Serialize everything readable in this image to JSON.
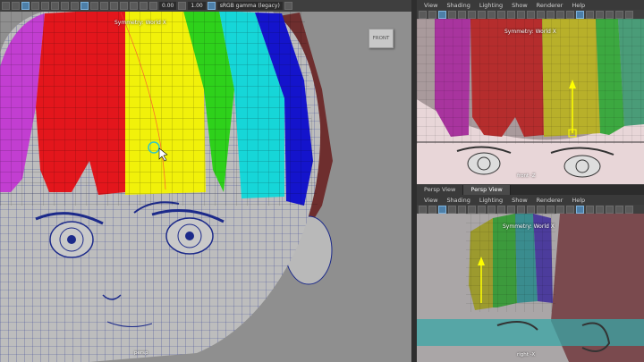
{
  "app": {
    "main_viewport": {
      "gamma_field": "sRGB gamma (legacy)",
      "exposure_value": "0.00",
      "gamma_value": "1.00",
      "symmetry_label": "Symmetry: World X",
      "view_cube_label": "FRONT",
      "camera_label": "persp"
    },
    "front_panel": {
      "menu": [
        "View",
        "Shading",
        "Lighting",
        "Show",
        "Renderer",
        "Help"
      ],
      "symmetry_label": "Symmetry: World X",
      "camera_label": "front -Z"
    },
    "panel_tabs": [
      "Persp View",
      "Persp View"
    ],
    "side_panel": {
      "menu": [
        "View",
        "Shading",
        "Lighting",
        "Show",
        "Renderer",
        "Help"
      ],
      "symmetry_label": "Symmetry: World X",
      "camera_label": "right -X"
    },
    "colors": {
      "bang_purple": "#c23ed1",
      "bang_red": "#e3161c",
      "bang_yellow": "#f1f10a",
      "bang_green": "#2ed11b",
      "bang_cyan": "#16d6d8",
      "bang_blue": "#1414cc",
      "wire": "#1c2a8a",
      "selection_teal": "#3aa6a6"
    }
  }
}
